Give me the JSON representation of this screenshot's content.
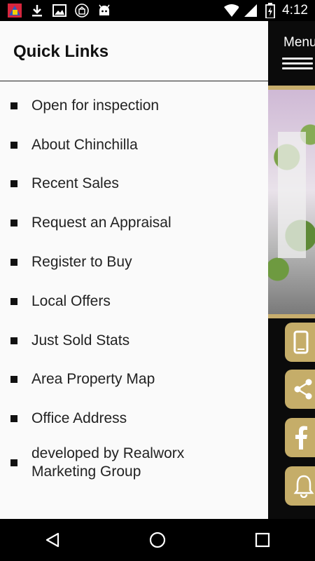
{
  "status_bar": {
    "time": "4:12",
    "icons": [
      "app-icon",
      "download-icon",
      "image-icon",
      "store-icon",
      "android-icon",
      "wifi-icon",
      "signal-icon",
      "battery-charging-icon"
    ]
  },
  "background_app": {
    "menu_label": "Menu",
    "side_buttons": [
      "phone-icon",
      "share-icon",
      "facebook-icon",
      "bell-icon"
    ]
  },
  "drawer": {
    "title": "Quick Links",
    "links": [
      "Open for inspection",
      "About Chinchilla",
      "Recent Sales",
      "Request an Appraisal",
      "Register to Buy",
      "Local Offers",
      "Just Sold Stats",
      "Area Property Map",
      "Office Address",
      "developed by Realworx\nMarketing Group"
    ]
  },
  "navbar": {
    "buttons": [
      "back-icon",
      "home-icon",
      "recents-icon"
    ]
  },
  "colors": {
    "accent_gold": "#c5ad69",
    "drawer_bg": "#fafafa"
  }
}
